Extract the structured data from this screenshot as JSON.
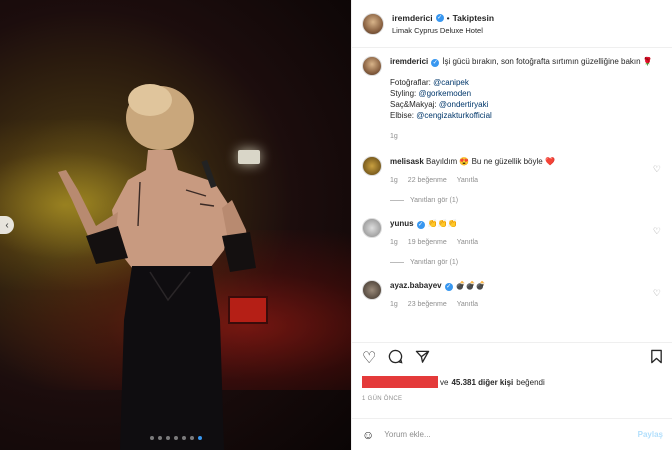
{
  "header": {
    "username": "iremderici",
    "separator": "•",
    "follow_label": "Takiptesin",
    "location": "Limak Cyprus Deluxe Hotel"
  },
  "caption": {
    "username": "iremderici",
    "text": "İşi gücü bırakın, son fotoğrafta sırtımın güzelliğine bakın 🌹",
    "credits": [
      {
        "label": "Fotoğraflar:",
        "mention": "@canipek"
      },
      {
        "label": "Styling:",
        "mention": "@gorkemoden"
      },
      {
        "label": "Saç&Makyaj:",
        "mention": "@ondertiryaki"
      },
      {
        "label": "Elbise:",
        "mention": "@cengizakturkofficial"
      }
    ],
    "time": "1g"
  },
  "comments": [
    {
      "username": "melisask",
      "text": "Bayıldım 😍 Bu ne güzellik böyle ❤️",
      "time": "1g",
      "likes": "22 beğenme",
      "reply": "Yanıtla",
      "view_replies": "Yanıtları gör (1)"
    },
    {
      "username": "yunus",
      "text": "👏👏👏",
      "time": "1g",
      "likes": "19 beğenme",
      "reply": "Yanıtla",
      "view_replies": "Yanıtları gör (1)"
    },
    {
      "username": "ayaz.babayev",
      "text": "💣💣💣",
      "time": "1g",
      "likes": "23 beğenme",
      "reply": "Yanıtla"
    }
  ],
  "likes": {
    "prefix": "ve",
    "count": "45.381 diğer kişi",
    "suffix": "beğendi"
  },
  "timestamp": "1 GÜN ÖNCE",
  "add_comment": {
    "placeholder": "Yorum ekle...",
    "post_label": "Paylaş"
  },
  "icons": {
    "heart": "heart-icon",
    "comment": "comment-icon",
    "share": "share-icon",
    "save": "bookmark-icon",
    "emoji": "emoji-icon"
  },
  "colors": {
    "verified": "#3897f0",
    "mention": "#00376b",
    "redaction": "#e43a3a"
  }
}
